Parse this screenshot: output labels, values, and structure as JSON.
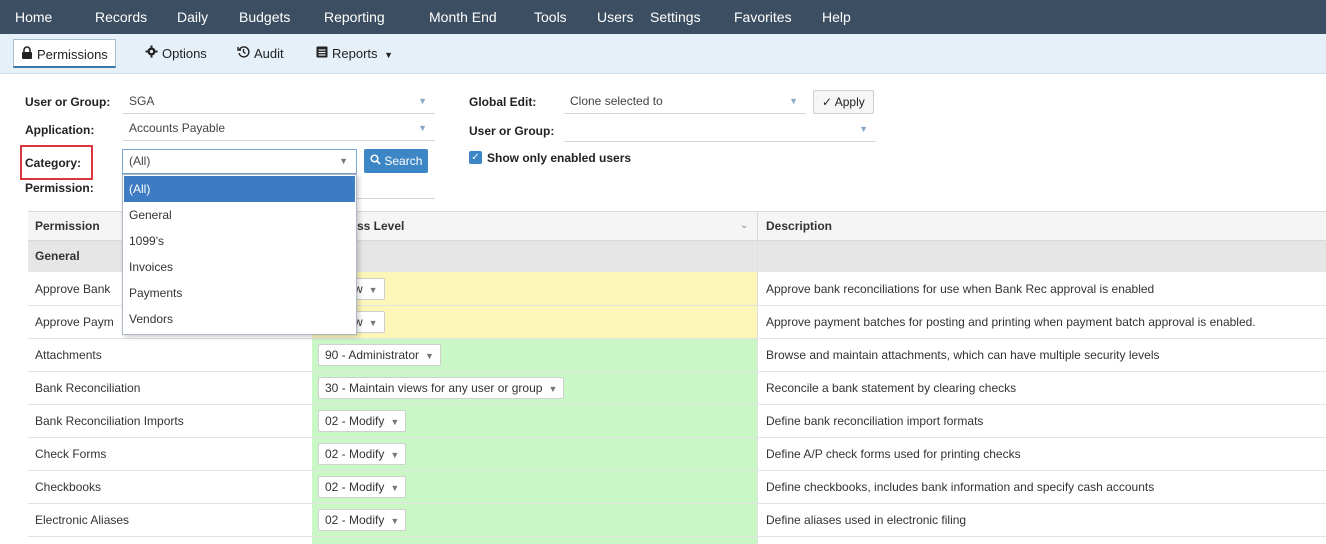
{
  "nav": {
    "items": [
      "Home",
      "Records",
      "Daily",
      "Budgets",
      "Reporting",
      "Month End",
      "Tools",
      "Users",
      "Settings",
      "Favorites",
      "Help"
    ]
  },
  "toolbar": {
    "permissions": "Permissions",
    "options": "Options",
    "audit": "Audit",
    "reports": "Reports"
  },
  "form": {
    "user_group_label": "User or Group:",
    "user_group_value": "SGA",
    "application_label": "Application:",
    "application_value": "Accounts Payable",
    "category_label": "Category:",
    "category_value": "(All)",
    "permission_label": "Permission:",
    "search_label": "Search",
    "global_edit_label": "Global Edit:",
    "global_edit_value": "Clone selected to",
    "apply_label": "Apply",
    "user_group2_label": "User or Group:",
    "user_group2_value": "",
    "show_enabled_label": "Show only enabled users"
  },
  "category_options": [
    "(All)",
    "General",
    "1099's",
    "Invoices",
    "Payments",
    "Vendors"
  ],
  "grid": {
    "headers": {
      "permission": "Permission",
      "access_level": "ss Level",
      "description": "Description"
    },
    "group_label": "General",
    "rows": [
      {
        "permission": "Approve Bank",
        "access": "llow",
        "description": "Approve bank reconciliations for use when Bank Rec approval is enabled"
      },
      {
        "permission": "Approve Paym",
        "access": "llow",
        "description": "Approve payment batches for posting and printing when payment batch approval is enabled."
      },
      {
        "permission": "Attachments",
        "access": "90 - Administrator",
        "description": "Browse and maintain attachments, which can have multiple security levels"
      },
      {
        "permission": "Bank Reconciliation",
        "access": "30 - Maintain views for any user or group",
        "description": "Reconcile a bank statement by clearing checks"
      },
      {
        "permission": "Bank Reconciliation Imports",
        "access": "02 - Modify",
        "description": "Define bank reconciliation import formats"
      },
      {
        "permission": "Check Forms",
        "access": "02 - Modify",
        "description": "Define A/P check forms used for printing checks"
      },
      {
        "permission": "Checkbooks",
        "access": "02 - Modify",
        "description": "Define checkbooks, includes bank information and specify cash accounts"
      },
      {
        "permission": "Electronic Aliases",
        "access": "02 - Modify",
        "description": "Define aliases used in electronic filing"
      }
    ]
  },
  "colors": {
    "nav_bg": "#3c4e61",
    "yellow_cell": "#fdf6b9",
    "green_cell": "#c9f7c6",
    "accent": "#3d86c6",
    "highlight": "#d9363e"
  }
}
